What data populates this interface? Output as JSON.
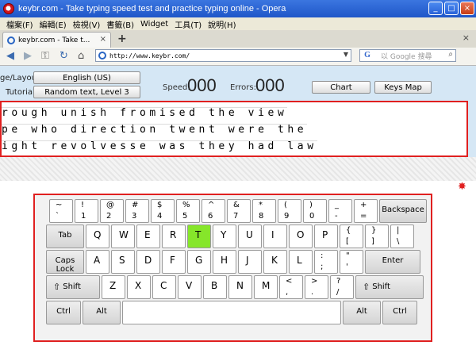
{
  "window": {
    "title": "keybr.com - Take typing speed test and practice typing online - Opera",
    "buttons": {
      "minimize": "_",
      "maximize": "□",
      "close": "×"
    }
  },
  "menu": [
    "檔案(F)",
    "編輯(E)",
    "檢視(V)",
    "書籤(B)",
    "Widget",
    "工具(T)",
    "說明(H)"
  ],
  "tabs": [
    {
      "label": "keybr.com - Take t...",
      "close": "×"
    }
  ],
  "tabbar": {
    "new_tab": "+",
    "close_all": "×"
  },
  "address": {
    "url": "http://www.keybr.com/",
    "search_placeholder": "以 Google 搜尋"
  },
  "controls": {
    "layout_label": "ge/Layout:",
    "layout_value": "English (US)",
    "tutorial_label": "Tutorial:",
    "tutorial_value": "Random text, Level 3",
    "speed_label": "Speed:",
    "speed_value": "000",
    "errors_label": "Errors:",
    "errors_value": "000",
    "chart_button": "Chart",
    "keysmap_button": "Keys Map"
  },
  "text_lines": [
    "rough unish fromised the view",
    "pe who direction twent were the",
    "ight revolvesse was they had law"
  ],
  "keyboard": {
    "active_key": "T",
    "rows": [
      [
        {
          "t": "~",
          "b": "`"
        },
        {
          "t": "!",
          "b": "1"
        },
        {
          "t": "@",
          "b": "2"
        },
        {
          "t": "#",
          "b": "3"
        },
        {
          "t": "$",
          "b": "4"
        },
        {
          "t": "%",
          "b": "5"
        },
        {
          "t": "^",
          "b": "6"
        },
        {
          "t": "&",
          "b": "7"
        },
        {
          "t": "*",
          "b": "8"
        },
        {
          "t": "(",
          "b": "9"
        },
        {
          "t": ")",
          "b": "0"
        },
        {
          "t": "_",
          "b": "-"
        },
        {
          "t": "+",
          "b": "="
        },
        {
          "m": "Backspace"
        }
      ],
      [
        {
          "m": "Tab"
        },
        {
          "s": "Q"
        },
        {
          "s": "W"
        },
        {
          "s": "E"
        },
        {
          "s": "R"
        },
        {
          "s": "T"
        },
        {
          "s": "Y"
        },
        {
          "s": "U"
        },
        {
          "s": "I"
        },
        {
          "s": "O"
        },
        {
          "s": "P"
        },
        {
          "t": "{",
          "b": "["
        },
        {
          "t": "}",
          "b": "]"
        },
        {
          "t": "|",
          "b": "\\"
        }
      ],
      [
        {
          "m": "Caps Lock"
        },
        {
          "s": "A"
        },
        {
          "s": "S"
        },
        {
          "s": "D"
        },
        {
          "s": "F"
        },
        {
          "s": "G"
        },
        {
          "s": "H"
        },
        {
          "s": "J"
        },
        {
          "s": "K"
        },
        {
          "s": "L"
        },
        {
          "t": ":",
          "b": ";"
        },
        {
          "t": "\"",
          "b": "'"
        },
        {
          "m": "Enter"
        }
      ],
      [
        {
          "m": "Shift"
        },
        {
          "s": "Z"
        },
        {
          "s": "X"
        },
        {
          "s": "C"
        },
        {
          "s": "V"
        },
        {
          "s": "B"
        },
        {
          "s": "N"
        },
        {
          "s": "M"
        },
        {
          "t": "<",
          "b": ","
        },
        {
          "t": ">",
          "b": "."
        },
        {
          "t": "?",
          "b": "/"
        },
        {
          "m": "Shift"
        }
      ],
      [
        {
          "m": "Ctrl"
        },
        {
          "m": "Alt"
        },
        {
          "m": ""
        },
        {
          "m": "Alt"
        },
        {
          "m": "Ctrl"
        }
      ]
    ]
  },
  "colors": {
    "active_key": "#86e62a",
    "highlight_border": "#e02020",
    "page_bg": "#d5e7f5"
  }
}
